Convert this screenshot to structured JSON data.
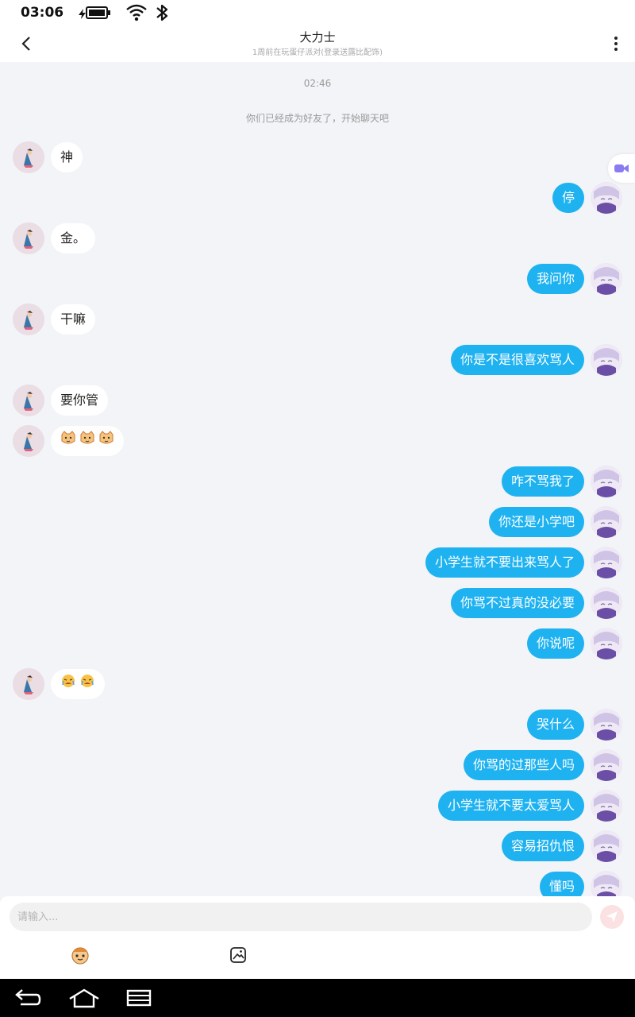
{
  "status_bar": {
    "time": "03:06",
    "icons": [
      "battery-charging-icon",
      "wifi-icon",
      "bluetooth-icon"
    ]
  },
  "header": {
    "title": "大力士",
    "subtitle": "1周前在玩蛋仔派对(登录送露比配饰)"
  },
  "chat": {
    "time_label": "02:46",
    "notice": "你们已经成为好友了，开始聊天吧",
    "messages": [
      {
        "side": "left",
        "text": "神"
      },
      {
        "side": "right",
        "text": "停"
      },
      {
        "side": "left",
        "text": "金。"
      },
      {
        "side": "right",
        "text": "我问你"
      },
      {
        "side": "left",
        "text": "干嘛"
      },
      {
        "side": "right",
        "text": "你是不是很喜欢骂人"
      },
      {
        "side": "left",
        "text": "要你管"
      },
      {
        "side": "left",
        "emoji": [
          "cat-face",
          "cat-face",
          "cat-face"
        ]
      },
      {
        "side": "right",
        "text": "咋不骂我了"
      },
      {
        "side": "right",
        "text": "你还是小学吧"
      },
      {
        "side": "right",
        "text": "小学生就不要出来骂人了"
      },
      {
        "side": "right",
        "text": "你骂不过真的没必要"
      },
      {
        "side": "right",
        "text": "你说呢"
      },
      {
        "side": "left",
        "emoji": [
          "crying-face",
          "crying-face"
        ]
      },
      {
        "side": "right",
        "text": "哭什么"
      },
      {
        "side": "right",
        "text": "你骂的过那些人吗"
      },
      {
        "side": "right",
        "text": "小学生就不要太爱骂人"
      },
      {
        "side": "right",
        "text": "容易招仇恨"
      },
      {
        "side": "right",
        "text": "懂吗"
      }
    ]
  },
  "input": {
    "placeholder": "请输入..."
  },
  "colors": {
    "outgoing_bubble": "#1fb2f0",
    "incoming_bubble": "#ffffff",
    "background": "#f2f4f7",
    "send_button": "#fbe1e1"
  }
}
